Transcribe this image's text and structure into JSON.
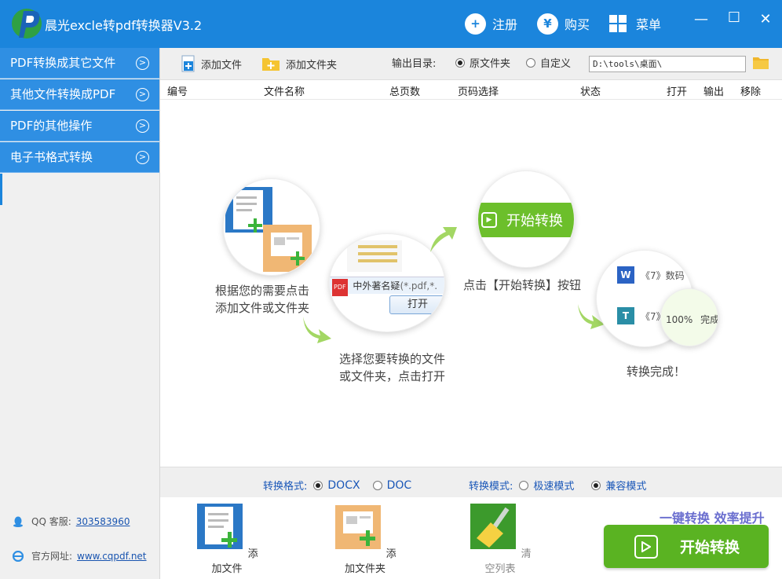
{
  "window": {
    "title": "晨光excle转pdf转换器V3.2",
    "register": "注册",
    "buy": "购买",
    "menu": "菜单"
  },
  "sidebar": {
    "items": [
      {
        "label": "PDF转换成其它文件"
      },
      {
        "label": "其他文件转换成PDF"
      },
      {
        "label": "PDF的其他操作"
      },
      {
        "label": "电子书格式转换"
      }
    ],
    "qq_label": "QQ 客服:",
    "qq_number": "303583960",
    "site_label": "官方网址:",
    "site_url": "www.cqpdf.net"
  },
  "toolbar": {
    "add_file": "添加文件",
    "add_folder": "添加文件夹",
    "output_label": "输出目录:",
    "opt_original": "原文件夹",
    "opt_custom": "自定义",
    "output_path": "D:\\tools\\桌面\\"
  },
  "table": {
    "columns": [
      "编号",
      "文件名称",
      "总页数",
      "页码选择",
      "状态",
      "打开",
      "输出",
      "移除"
    ]
  },
  "guide": {
    "step1": [
      "根据您的需要点击",
      "添加文件或文件夹"
    ],
    "step2": [
      "选择您要转换的文件",
      "或文件夹，点击打开"
    ],
    "step3": "点击【开始转换】按钮",
    "step4": "转换完成！",
    "dialog_file": "中外著名疑",
    "dialog_filter": "(*.pdf,*.",
    "dialog_open": "打开",
    "start_label": "开始转换",
    "item_w": "《7》数码",
    "item_t": "《7》",
    "progress": "100%",
    "done": "完成"
  },
  "options": {
    "format_label": "转换格式:",
    "format_docx": "DOCX",
    "format_doc": "DOC",
    "mode_label": "转换模式:",
    "mode_fast": "极速模式",
    "mode_compat": "兼容模式"
  },
  "bottom": {
    "add_file": "添加文件",
    "add_folder": "添加文件夹",
    "clear_list": "清空列表",
    "slogan": "一键转换 效率提升",
    "start": "开始转换"
  },
  "colors": {
    "primary": "#1b85dc",
    "sidebar_item": "#2f8fe3",
    "green": "#5ab322",
    "link": "#1a57b8"
  }
}
